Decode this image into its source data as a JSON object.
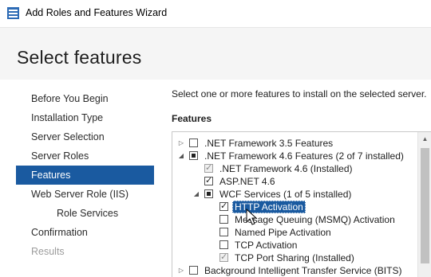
{
  "window": {
    "title": "Add Roles and Features Wizard"
  },
  "page": {
    "title": "Select features"
  },
  "nav": {
    "items": [
      {
        "label": "Before You Begin",
        "state": "normal"
      },
      {
        "label": "Installation Type",
        "state": "normal"
      },
      {
        "label": "Server Selection",
        "state": "normal"
      },
      {
        "label": "Server Roles",
        "state": "normal"
      },
      {
        "label": "Features",
        "state": "active"
      },
      {
        "label": "Web Server Role (IIS)",
        "state": "normal"
      },
      {
        "label": "Role Services",
        "state": "sub"
      },
      {
        "label": "Confirmation",
        "state": "normal"
      },
      {
        "label": "Results",
        "state": "disabled"
      }
    ]
  },
  "main": {
    "description": "Select one or more features to install on the selected server.",
    "features_label": "Features",
    "tree": [
      {
        "label": ".NET Framework 3.5 Features",
        "expander": "collapsed",
        "check": "unchecked",
        "selected": false
      },
      {
        "label": ".NET Framework 4.6 Features (2 of 7 installed)",
        "expander": "expanded",
        "check": "partial",
        "selected": false
      },
      {
        "label": ".NET Framework 4.6 (Installed)",
        "expander": "none",
        "check": "checked-disabled",
        "selected": false
      },
      {
        "label": "ASP.NET 4.6",
        "expander": "none",
        "check": "checked",
        "selected": false
      },
      {
        "label": "WCF Services (1 of 5 installed)",
        "expander": "expanded",
        "check": "partial",
        "selected": false
      },
      {
        "label": "HTTP Activation",
        "expander": "none",
        "check": "checked",
        "selected": true
      },
      {
        "label": "Message Queuing (MSMQ) Activation",
        "expander": "none",
        "check": "unchecked",
        "selected": false
      },
      {
        "label": "Named Pipe Activation",
        "expander": "none",
        "check": "unchecked",
        "selected": false
      },
      {
        "label": "TCP Activation",
        "expander": "none",
        "check": "unchecked",
        "selected": false
      },
      {
        "label": "TCP Port Sharing (Installed)",
        "expander": "none",
        "check": "checked-disabled",
        "selected": false
      },
      {
        "label": "Background Intelligent Transfer Service (BITS)",
        "expander": "collapsed",
        "check": "unchecked",
        "selected": false
      }
    ]
  },
  "colors": {
    "accent": "#1a5aa0",
    "header_bg": "#f5f5f5"
  },
  "icons": {
    "app": "server-manager-icon",
    "expand": "triangle-right-icon",
    "collapse": "triangle-down-icon",
    "cursor": "mouse-pointer-icon"
  }
}
